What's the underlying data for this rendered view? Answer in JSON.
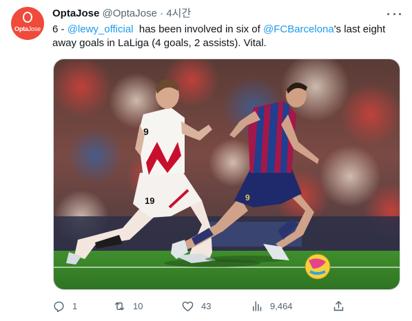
{
  "author": {
    "display_name": "OptaJose",
    "handle": "@OptaJose",
    "separator": "·",
    "time": "4시간",
    "avatar_text_bold": "Opta",
    "avatar_text_light": "Jose"
  },
  "tweet": {
    "part1": "6 - ",
    "mention1": "@lewy_official",
    "part2": "  has been involved in six of ",
    "mention2": "@FCBarcelona",
    "part3": "'s last eight away goals in LaLiga (4 goals, 2 assists). Vital."
  },
  "media": {
    "player_left_number": "19",
    "player_right_number": "9"
  },
  "actions": {
    "replies": "1",
    "retweets": "10",
    "likes": "43",
    "views": "9,464"
  },
  "colors": {
    "accent": "#1d9bf0",
    "muted": "#536471",
    "avatar_bg": "#ef4a3a",
    "pitch": "#3d8a2c"
  }
}
